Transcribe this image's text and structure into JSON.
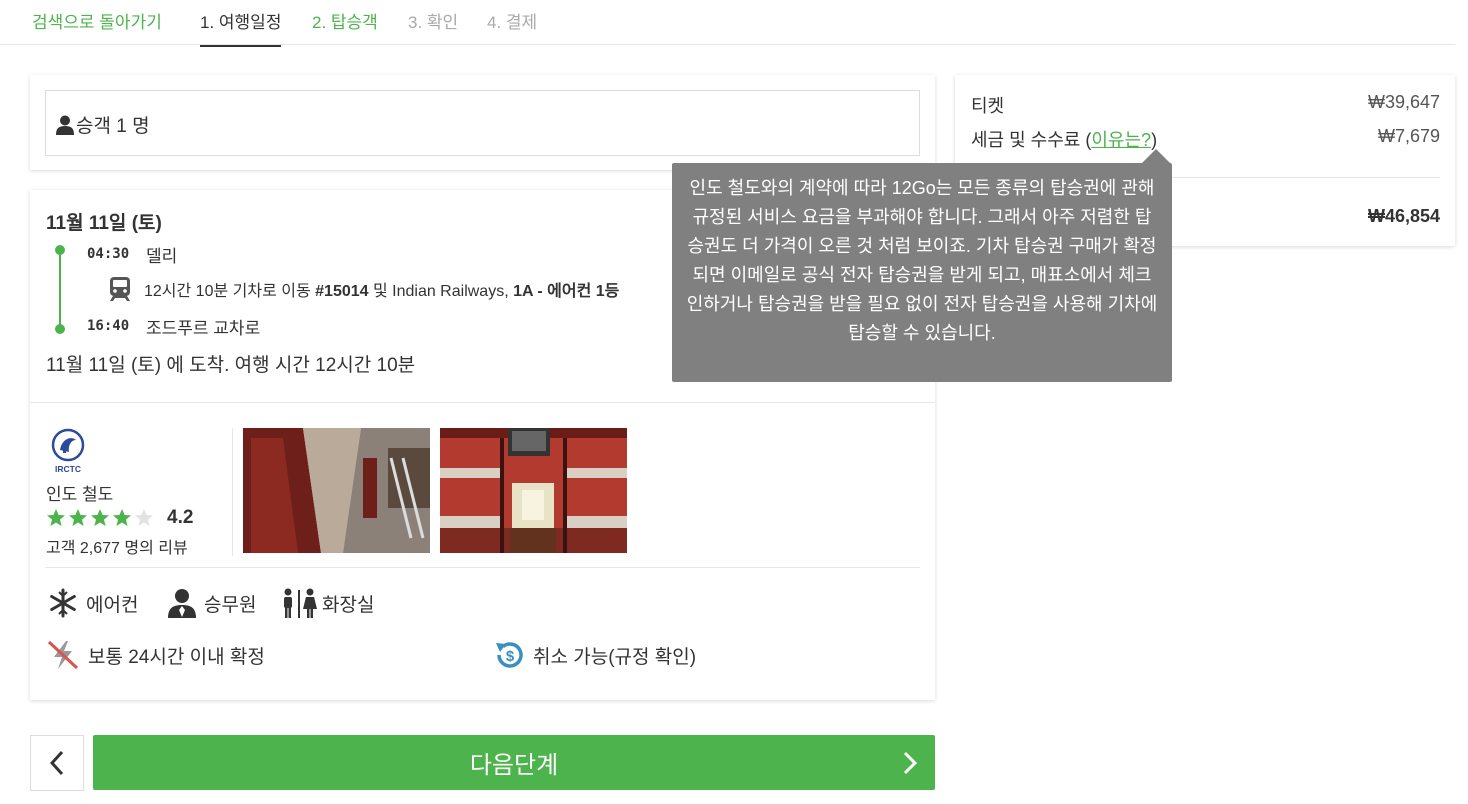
{
  "steps": {
    "back": "검색으로 돌아가기",
    "step1": "1. 여행일정",
    "step2": "2. 탑승객",
    "step3": "3. 확인",
    "step4": "4. 결제"
  },
  "passengers": {
    "label": "승객 1 명"
  },
  "trip": {
    "date": "11월 11일 (토)",
    "depart_time": "04:30",
    "depart_place": "델리",
    "train_pre": "12시간 10분 기차로 이동 ",
    "train_no": "#15014",
    "train_mid": " 및 Indian Railways, ",
    "train_class": "1A - 에어컨 1등",
    "arrive_time": "16:40",
    "arrive_place": "조드푸르 교차로",
    "arrival_summary": "11월 11일 (토) 에 도착. 여행 시간 12시간 10분"
  },
  "operator": {
    "logo_text": "IRCTC",
    "name": "인도 철도",
    "rating": "4.2",
    "rating_value": 4.2,
    "reviews": "고객 2,677 명의 리뷰"
  },
  "amenities": {
    "ac": "에어컨",
    "staff": "승무원",
    "toilet": "화장실",
    "confirm": "보통 24시간 이내 확정",
    "cancel": "취소 가능(규정 확인)"
  },
  "nav": {
    "next": "다음단계"
  },
  "summary": {
    "ticket_label": "티켓",
    "ticket_value": "₩39,647",
    "tax_label": "세금 및 수수료 (",
    "tax_link": "이유는?",
    "tax_close": ")",
    "tax_value": "₩7,679",
    "total_value": "₩46,854"
  },
  "tooltip": {
    "text": "인도 철도와의 계약에 따라 12Go는 모든 종류의 탑승권에 관해 규정된 서비스 요금을 부과해야 합니다. 그래서 아주 저렴한 탑승권도 더 가격이 오른 것 처럼 보이죠. 기차 탑승권 구매가 확정되면 이메일로 공식 전자 탑승권을 받게 되고, 매표소에서 체크인하거나 탑승권을 받을 필요 없이 전자 탑승권을 사용해 기차에 탑승할 수 있습니다."
  },
  "colors": {
    "accent": "#4db34d",
    "tooltip": "#808080",
    "icon_blue": "#3b8fbf"
  }
}
